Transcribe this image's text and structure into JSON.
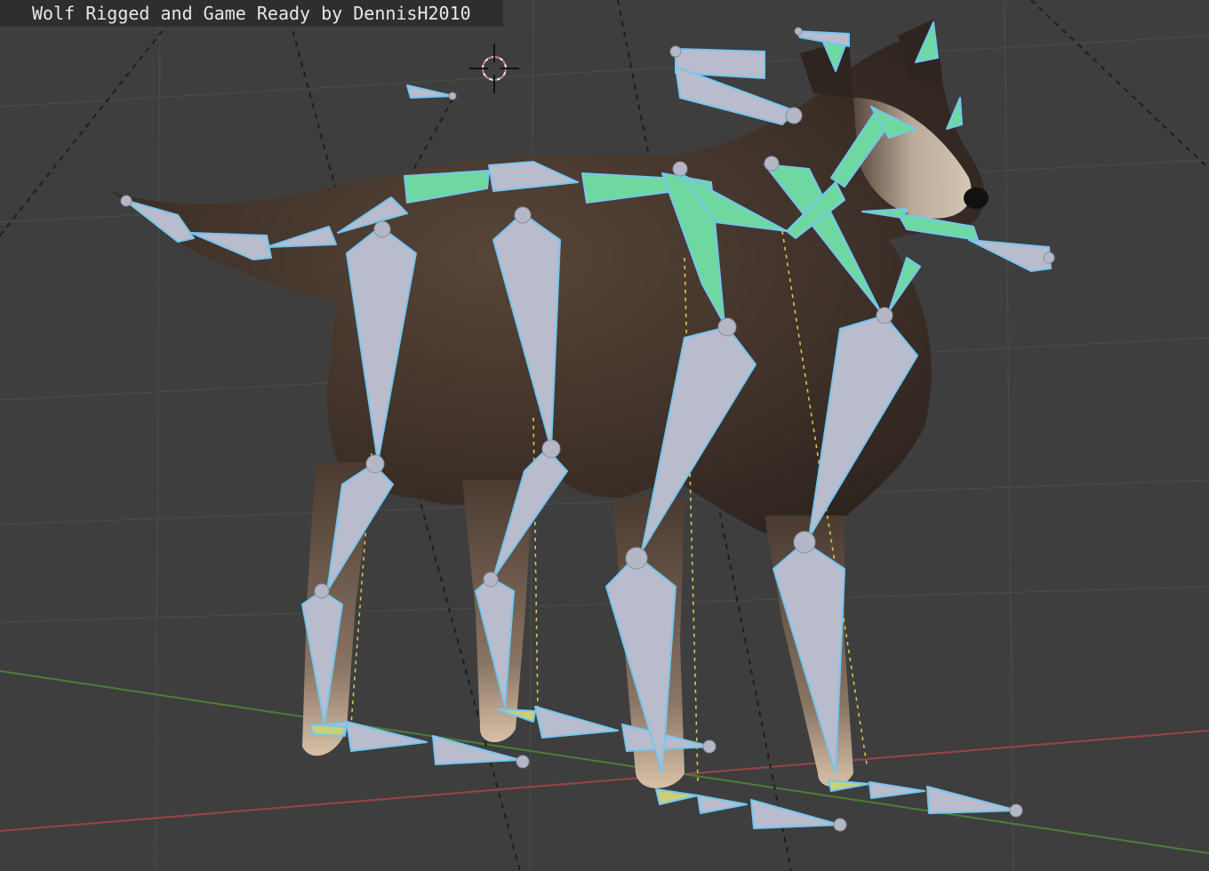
{
  "viewport": {
    "title": "Wolf Rigged and Game Ready by DennisH2010"
  },
  "colors": {
    "background": "#3e3e3e",
    "bone_fill": "#b9bccc",
    "bone_outline": "#74c6f0",
    "bone_selected": "#6fd8a0",
    "fur_dark": "#3b2e26",
    "axis_x": "#b04848",
    "axis_y": "#4f8a3a",
    "relationship_line": "#e5c84a"
  },
  "icons": {
    "cursor": "3d-cursor-icon"
  }
}
